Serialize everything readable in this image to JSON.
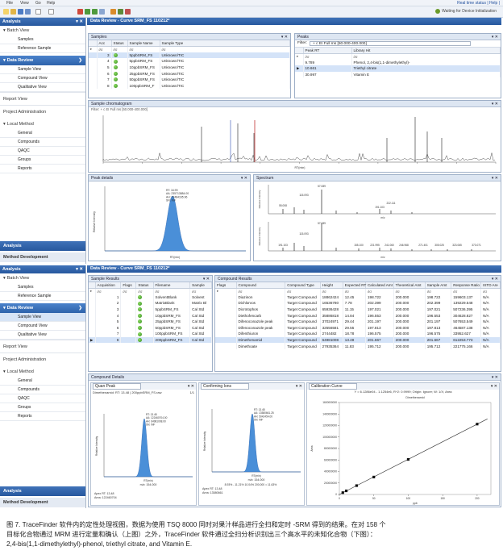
{
  "menu": [
    "File",
    "View",
    "Go",
    "Help"
  ],
  "top_links": "Real time status | Help | ",
  "status_text": "Waiting for Device Initialization",
  "screen1": {
    "sidebar_title": "Analysis",
    "groups": [
      {
        "label": "Batch View",
        "items": [
          "Samples",
          "Reference Sample"
        ]
      },
      {
        "label": "Data Review",
        "items": [
          "Sample View",
          "Compound View",
          "Qualitative View"
        ]
      }
    ],
    "sections": [
      "Report View",
      "Project Administration"
    ],
    "local_method": {
      "label": "Local Method",
      "items": [
        "General",
        "Compounds",
        "QAQC",
        "Groups",
        "Reports"
      ]
    },
    "footer": [
      "Analysis",
      "Method Development"
    ],
    "panel_title": "Data Review - Curve SRM_FS 110212*",
    "samples": {
      "title": "Samples",
      "columns": [
        "Acc",
        "Status",
        "Sample Name",
        "Sample Type"
      ],
      "filter": [
        "∂σ",
        "∂σ",
        "∂σ"
      ],
      "rows": [
        [
          "3",
          "5ppbSRM_FS",
          "Unknown/TIC"
        ],
        [
          "4",
          "5ppbSRM_FS",
          "Unknown/TIC"
        ],
        [
          "5",
          "10ppbSRM_FS",
          "Unknown/TIC"
        ],
        [
          "6",
          "25ppbSRM_FS",
          "Unknown/TIC"
        ],
        [
          "7",
          "50ppbSRM_FS",
          "Unknown/TIC"
        ],
        [
          "8",
          "100ppbSRM_F",
          "Unknown/TIC"
        ]
      ]
    },
    "peaks": {
      "title": "Peaks",
      "filter_label": "Filter:",
      "filter_value": "+ c EI Full ms [50.000-400.000]",
      "columns": [
        "Peak RT",
        "Library Hit"
      ],
      "filter": [
        "∂σ",
        "∂σ"
      ],
      "rows": [
        [
          "9.789",
          "Phenol, 2,4-bis(1,1-dimethylethyl)-"
        ],
        [
          "10.661",
          "Triethyl citrate"
        ],
        [
          "30.997",
          "Vitamin E"
        ]
      ]
    },
    "chromatogram": {
      "title": "Sample chromatogram",
      "filter": "Filter: + c EI Full ms [50.000-400.000]",
      "xlabel": "RT(min)"
    },
    "peak_details": {
      "title": "Peak details",
      "ylabel": "Relative Intensity",
      "xlabel": "RT(min)",
      "labels": [
        "RT: 16.99",
        "AA: 235713884.00",
        "AH: 72484165.96",
        "SN: INF"
      ]
    },
    "spectrum": {
      "title": "Spectrum",
      "ylabel": "Relative Intensity",
      "xlabel": "m/z",
      "top_labels": [
        "57.089",
        "115.093",
        "191.103",
        "55.008",
        "222.111"
      ],
      "bottom_labels": [
        "57.089",
        "115.093",
        "191.103",
        "155.100",
        "221.995",
        "241.060",
        "246.968",
        "271.401",
        "305.025",
        "323.065",
        "373.071"
      ]
    }
  },
  "screen2": {
    "sidebar_title": "Analysis",
    "groups": [
      {
        "label": "Batch View",
        "items": [
          "Samples",
          "Reference Sample"
        ]
      },
      {
        "label": "Data Review",
        "items": [
          "Sample View",
          "Compound View",
          "Qualitative View"
        ]
      }
    ],
    "sections": [
      "Report View",
      "Project Administration"
    ],
    "local_method": {
      "label": "Local Method",
      "items": [
        "General",
        "Compounds",
        "QAQC",
        "Groups",
        "Reports"
      ]
    },
    "footer": [
      "Analysis",
      "Method Development"
    ],
    "panel_title": "Data Review - Curve SRM_FS 110212*",
    "sample_results": {
      "title": "Sample Results",
      "columns": [
        "Acquisition",
        "Flags",
        "Status",
        "Filename",
        "Sample"
      ],
      "filter": [
        "∂σ",
        "∂σ",
        "∂σ",
        "∂σ",
        "∂σ"
      ],
      "rows": [
        [
          "1",
          "SolventBlank",
          "Solvent"
        ],
        [
          "2",
          "MatrixBlank",
          "Matrix Bl"
        ],
        [
          "3",
          "5ppbSRM_FS",
          "Cal Std"
        ],
        [
          "4",
          "10ppbSRM_FS",
          "Cal Std"
        ],
        [
          "5",
          "25ppbSRM_FS",
          "Cal Std"
        ],
        [
          "6",
          "50ppbSRM_FS",
          "Cal Std"
        ],
        [
          "7",
          "100ppbSRM_FS",
          "Cal Std"
        ],
        [
          "8",
          "200ppbSRM_FS",
          "Cal Std"
        ]
      ]
    },
    "compound_results": {
      "title": "Compound Results",
      "columns": [
        "Flags",
        "Compound",
        "Compound Type",
        "Height",
        "Expected RT",
        "Calculated Amt",
        "Theoretical Amt",
        "Sample Amt",
        "Response Ratio",
        "ISTD Are"
      ],
      "rows": [
        [
          "Diazinon",
          "Target Compound",
          "18862424",
          "12.45",
          "198.722",
          "200.000",
          "198.722",
          "159603.137",
          "N/A"
        ],
        [
          "Dichlorvos",
          "Target Compound",
          "16536780",
          "7.78",
          "202.399",
          "200.000",
          "202.399",
          "139229.548",
          "N/A"
        ],
        [
          "Dicrotophos",
          "Target Compound",
          "65936428",
          "11.15",
          "197.021",
          "200.000",
          "197.021",
          "507236.395",
          "N/A"
        ],
        [
          "Diethofencarb",
          "Target Compound",
          "35886818",
          "14.84",
          "196.553",
          "200.000",
          "196.553",
          "304628.827",
          "N/A"
        ],
        [
          "Difenoconazole peak",
          "Target Compound",
          "37024971",
          "29.44",
          "201.197",
          "200.000",
          "201.197",
          "507653.549",
          "N/A"
        ],
        [
          "Difenoconazole peak",
          "Target Compound",
          "32556581",
          "29.55",
          "197.813",
          "200.000",
          "197.813",
          "464587.138",
          "N/A"
        ],
        [
          "Difenthiuron",
          "Target Compound",
          "2744482",
          "18.78",
          "196.575",
          "200.000",
          "196.575",
          "33952.627",
          "N/A"
        ],
        [
          "Dimethenamid",
          "Target Compound",
          "64981008",
          "13.48",
          "201.667",
          "200.000",
          "201.667",
          "612253.773",
          "N/A"
        ],
        [
          "Dimethoate",
          "Target Compound",
          "27935364",
          "11.83",
          "195.712",
          "200.000",
          "195.712",
          "221775.166",
          "N/A"
        ]
      ]
    },
    "compound_details": {
      "title": "Compound Details",
      "quan_peak": "Quan Peak",
      "quan_peak_header": "Dimethenamid: RT: 13.48 | 200ppbSRM_FS.raw",
      "page": "1/1",
      "confirming": "Confirming Ions",
      "calibration": "Calibration Curve",
      "quan_labels": [
        "RT: 13.48",
        "AA: 122460704.00",
        "AH: 64981008.00",
        "SN: INF"
      ],
      "conf_labels": [
        "RT: 13.48",
        "AA: 13580661.25",
        "AH: 5042454.00",
        "SN: INF"
      ],
      "quan_mz": "m/z: 154.000",
      "conf_mz": "m/z: 154.000",
      "conf_ratio": "8.93% - 11.21% 10.04% 200.000 = 11.63%",
      "apex_rt_label": "Apex RT: 13.48",
      "apex_area_label": "Area: 122460704",
      "conf_apex_rt_label": "Apex RT: 13.48",
      "conf_area_label": "Area: 13580661",
      "curve_title": "Dimethenamid",
      "curve_eq": "Y = 6.1286e04 - 1.1254e6, R^2: 0.9999; Origin: Ignore; W: 1/X; Area",
      "xlabel": "ppb",
      "ylabel": "Area",
      "ylabel_peaks": "Relative Intensity",
      "xlabel_peaks": "RT(min)",
      "y_ticks": [
        "1600000000",
        "1400000000",
        "1200000000",
        "1000000000",
        "800000000",
        "600000000",
        "400000000",
        "200000000",
        "0"
      ],
      "x_ticks": [
        "0",
        "50",
        "100",
        "150",
        "200"
      ],
      "points": [
        [
          5,
          3200000
        ],
        [
          10,
          6300000
        ],
        [
          25,
          15400000
        ],
        [
          50,
          30300000
        ],
        [
          100,
          61000000
        ],
        [
          200,
          122460704
        ]
      ]
    }
  },
  "chart_data": {
    "type": "scatter",
    "title": "Dimethenamid",
    "xlabel": "ppb",
    "ylabel": "Area",
    "x": [
      5,
      10,
      25,
      50,
      100,
      200
    ],
    "y": [
      3200000,
      6300000,
      15400000,
      30300000,
      61000000,
      122460704
    ],
    "xlim": [
      0,
      220
    ],
    "ylim": [
      0,
      160000000
    ]
  },
  "caption": [
    "图 7. TraceFinder 软件内的定性处理视图，数据为使用 TSQ 8000 同时对果汁样品进行全扫和定时 -SRM 得到的结果。在对 158 个",
    "目标化合物通过 MRM 进行定量和确认（上图）之外，TraceFinder 软件通过全扫分析识别出三个高水平的未知化合物（下图）：",
    "2,4-bis(1,1-dimethylethyl)-phenol, triethyl citrate, and Vitamin E."
  ]
}
